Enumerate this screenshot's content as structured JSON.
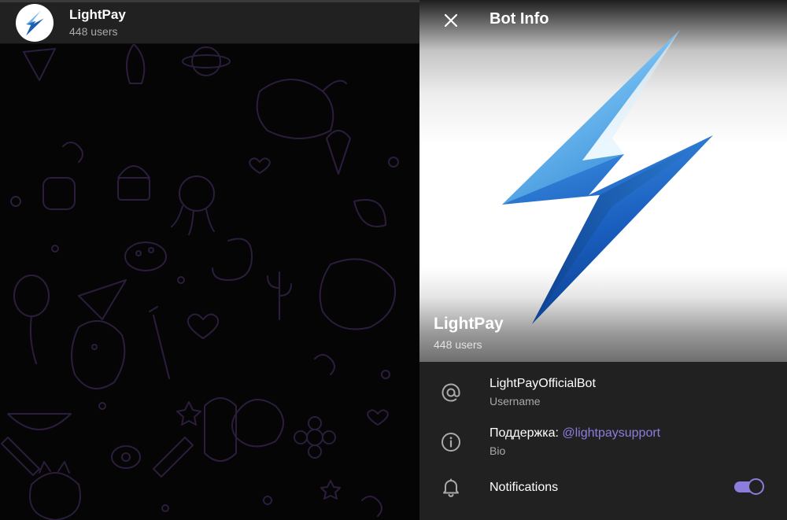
{
  "chat": {
    "name": "LightPay",
    "subtitle": "448 users",
    "avatar_icon": "lightning-bolt-icon"
  },
  "info_panel": {
    "title": "Bot Info",
    "close_icon": "close-icon",
    "hero": {
      "name": "LightPay",
      "subtitle": "448 users"
    },
    "username": {
      "value": "LightPayOfficialBot",
      "label": "Username",
      "icon": "at-sign-icon"
    },
    "bio": {
      "prefix": "Поддержка: ",
      "link": "@lightpaysupport",
      "label": "Bio",
      "icon": "info-icon"
    },
    "notifications": {
      "label": "Notifications",
      "icon": "bell-icon",
      "enabled": true
    }
  },
  "colors": {
    "accent": "#8e7cdd",
    "panel_bg": "#212121",
    "chat_bg": "#050505",
    "pattern": "#2c1d3d",
    "bolt_light": "#7ec3f0",
    "bolt_dark": "#0d47a1"
  }
}
